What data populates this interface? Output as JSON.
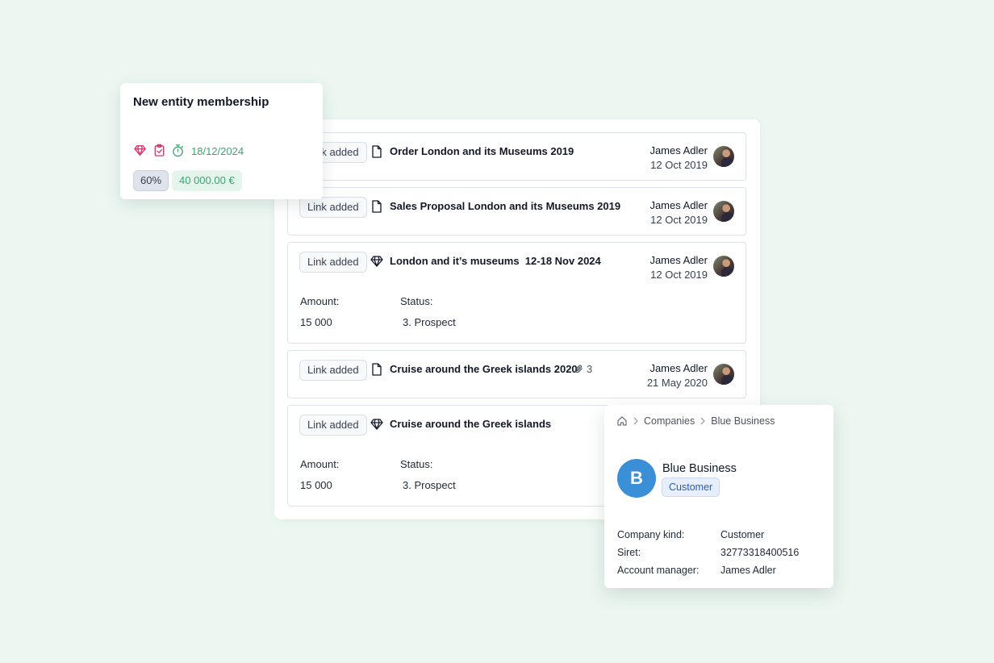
{
  "membership": {
    "title": "New entity membership",
    "date": "18/12/2024",
    "percent": "60%",
    "amount": "40 000.00 €",
    "icons": [
      "diamond-icon",
      "clipboard-check-icon",
      "stopwatch-icon"
    ],
    "colors": {
      "icon_pink": "#d6336c",
      "accent_green": "#3aa56f"
    }
  },
  "timeline": {
    "events": [
      {
        "chip": "Link added",
        "icon": "document-icon",
        "title": "Order London and its Museums 2019",
        "author": "James Adler",
        "date": "12 Oct 2019"
      },
      {
        "chip": "Link added",
        "icon": "document-icon",
        "title": "Sales Proposal London and its Museums 2019",
        "author": "James Adler",
        "date": "12 Oct 2019"
      },
      {
        "chip": "Link added",
        "icon": "diamond-icon",
        "title": "London and it’s museums  12-18 Nov 2024",
        "author": "James Adler",
        "date": "12 Oct 2019",
        "amount_label": "Amount:",
        "amount": "15 000",
        "status_label": "Status:",
        "status": "3. Prospect"
      },
      {
        "chip": "Link added",
        "icon": "document-icon",
        "title": "Cruise around the Greek islands 2020",
        "attachments": "3",
        "author": "James Adler",
        "date": "21 May 2020"
      },
      {
        "chip": "Link added",
        "icon": "diamond-icon",
        "title": "Cruise around the Greek islands",
        "amount_label": "Amount:",
        "amount": "15 000",
        "status_label": "Status:",
        "status": "3. Prospect"
      }
    ]
  },
  "company": {
    "breadcrumb": [
      "Companies",
      "Blue Business"
    ],
    "initial": "B",
    "name": "Blue Business",
    "tag": "Customer",
    "fields": [
      {
        "label": "Company kind:",
        "value": "Customer"
      },
      {
        "label": "Siret:",
        "value": "32773318400516"
      },
      {
        "label": "Account manager:",
        "value": "James Adler"
      }
    ],
    "colors": {
      "avatar": "#3b8fd6"
    }
  }
}
